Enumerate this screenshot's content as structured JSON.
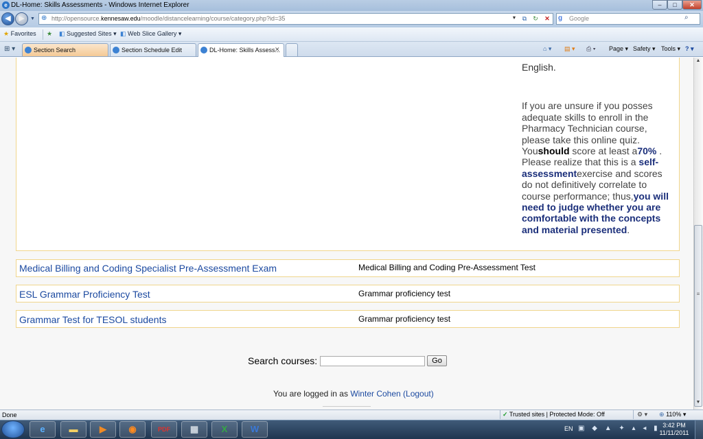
{
  "window": {
    "title": "DL-Home: Skills Assessments - Windows Internet Explorer",
    "min": "–",
    "max": "□",
    "close": "✕"
  },
  "address": {
    "url_prefix": "http://opensource.",
    "url_host": "kennesaw.edu",
    "url_path": "/moodle/distancelearning/course/category.php?id=35",
    "search_placeholder": "Google"
  },
  "favorites_bar": {
    "favorites_label": "Favorites",
    "suggested_sites": "Suggested Sites ▾",
    "web_slice": "Web Slice Gallery ▾"
  },
  "tabs": [
    {
      "label": "Section Search"
    },
    {
      "label": "Section Schedule Edit"
    },
    {
      "label": "DL-Home: Skills Assess..."
    }
  ],
  "command_bar": {
    "page": "Page ▾",
    "safety": "Safety ▾",
    "tools": "Tools ▾",
    "help": "? ▾"
  },
  "content": {
    "description_top": "English.",
    "description_p1": "If you are unsure if you posses adequate skills to enroll in the Pharmacy Technician course, please take this online quiz.",
    "you": "You",
    "should": "should",
    "score_text": " score at least a",
    "score_value": "70%",
    "realize_text": " . Please realize that this is a ",
    "self_assessment": "self-assessment",
    "exercise_text": "exercise and scores do not definitively correlate to course performance; thus,",
    "judge_text": "you will need to judge whether you are comfortable with the concepts and material presented",
    "period": ".",
    "courses": [
      {
        "name": "Medical Billing and Coding Specialist Pre-Assessment Exam",
        "summary": "Medical Billing and Coding Pre-Assessment Test"
      },
      {
        "name": "ESL Grammar Proficiency Test",
        "summary": "Grammar proficiency test"
      },
      {
        "name": "Grammar Test for TESOL students",
        "summary": "Grammar proficiency test"
      }
    ],
    "search_label": "Search courses:",
    "search_go": "Go",
    "login_prefix": "You are logged in as ",
    "login_user": "Winter Cohen",
    "logout": "(Logout)"
  },
  "status_bar": {
    "status": "Done",
    "zone": "Trusted sites | Protected Mode: Off",
    "zoom": "110% ▾"
  },
  "taskbar": {
    "lang": "EN",
    "time": "3:42 PM",
    "date": "11/11/2011",
    "apps": [
      "ie-icon",
      "folder-icon",
      "media-player-icon",
      "firefox-icon",
      "pdf-icon",
      "calculator-icon",
      "excel-icon",
      "word-icon"
    ]
  }
}
